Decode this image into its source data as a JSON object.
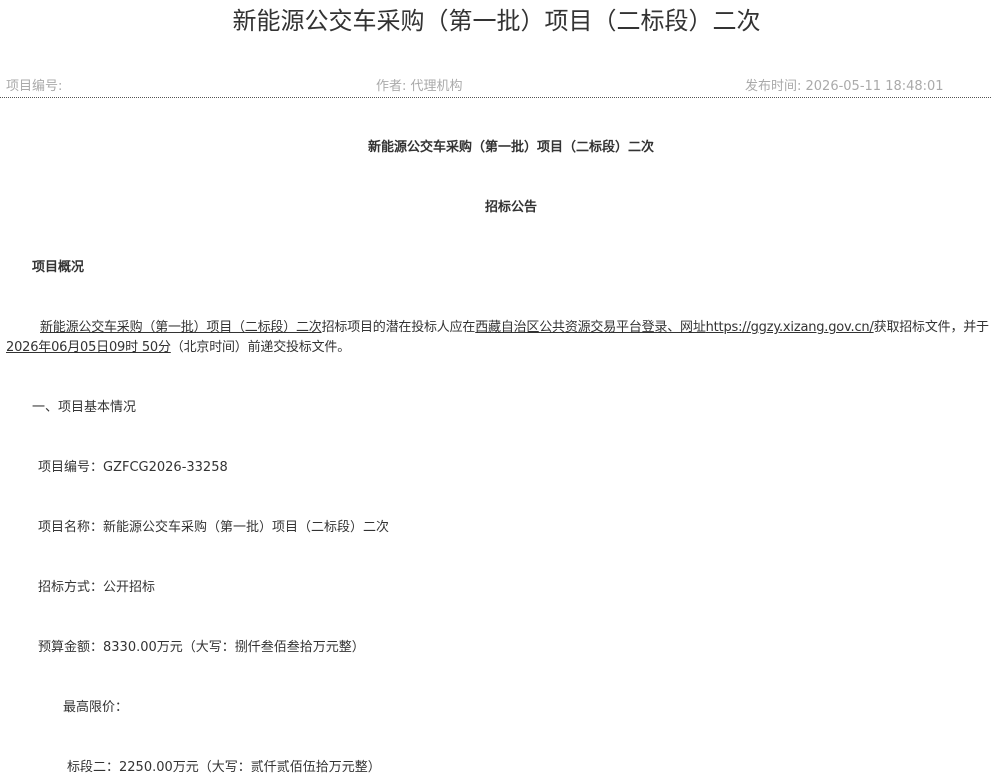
{
  "page_title": "新能源公交车采购（第一批）项目（二标段）二次",
  "meta": {
    "project_no_label": "项目编号:",
    "author": "作者: 代理机构",
    "publish_time": "发布时间: 2026-05-11 18:48:01"
  },
  "content": {
    "subtitle": "新能源公交车采购（第一批）项目（二标段）二次",
    "notice_type": "招标公告",
    "overview_heading": "项目概况",
    "overview_para": {
      "project_name": "新能源公交车采购（第一批）项目（二标段）二次",
      "text_1": "招标项目的潜在投标人应在",
      "platform": "西藏自治区公共资源交易平台登录、网址",
      "url": "https://ggzy.xizang.gov.cn/",
      "text_2": "获取招标文件，并于",
      "deadline": "2026年06月05日09时 50分",
      "text_3": "（北京时间）前递交投标文件。"
    },
    "section_1_heading": "一、项目基本情况",
    "project_no": "项目编号：GZFCG2026-33258",
    "project_name_line": "项目名称：新能源公交车采购（第一批）项目（二标段）二次",
    "bid_method": "招标方式：公开招标",
    "budget": "预算金额：8330.00万元（大写：捌仟叁佰叁拾万元整）",
    "max_price_label": "最高限价：",
    "lot_two": "标段二：2250.00万元（大写：贰仟贰佰伍拾万元整）"
  }
}
